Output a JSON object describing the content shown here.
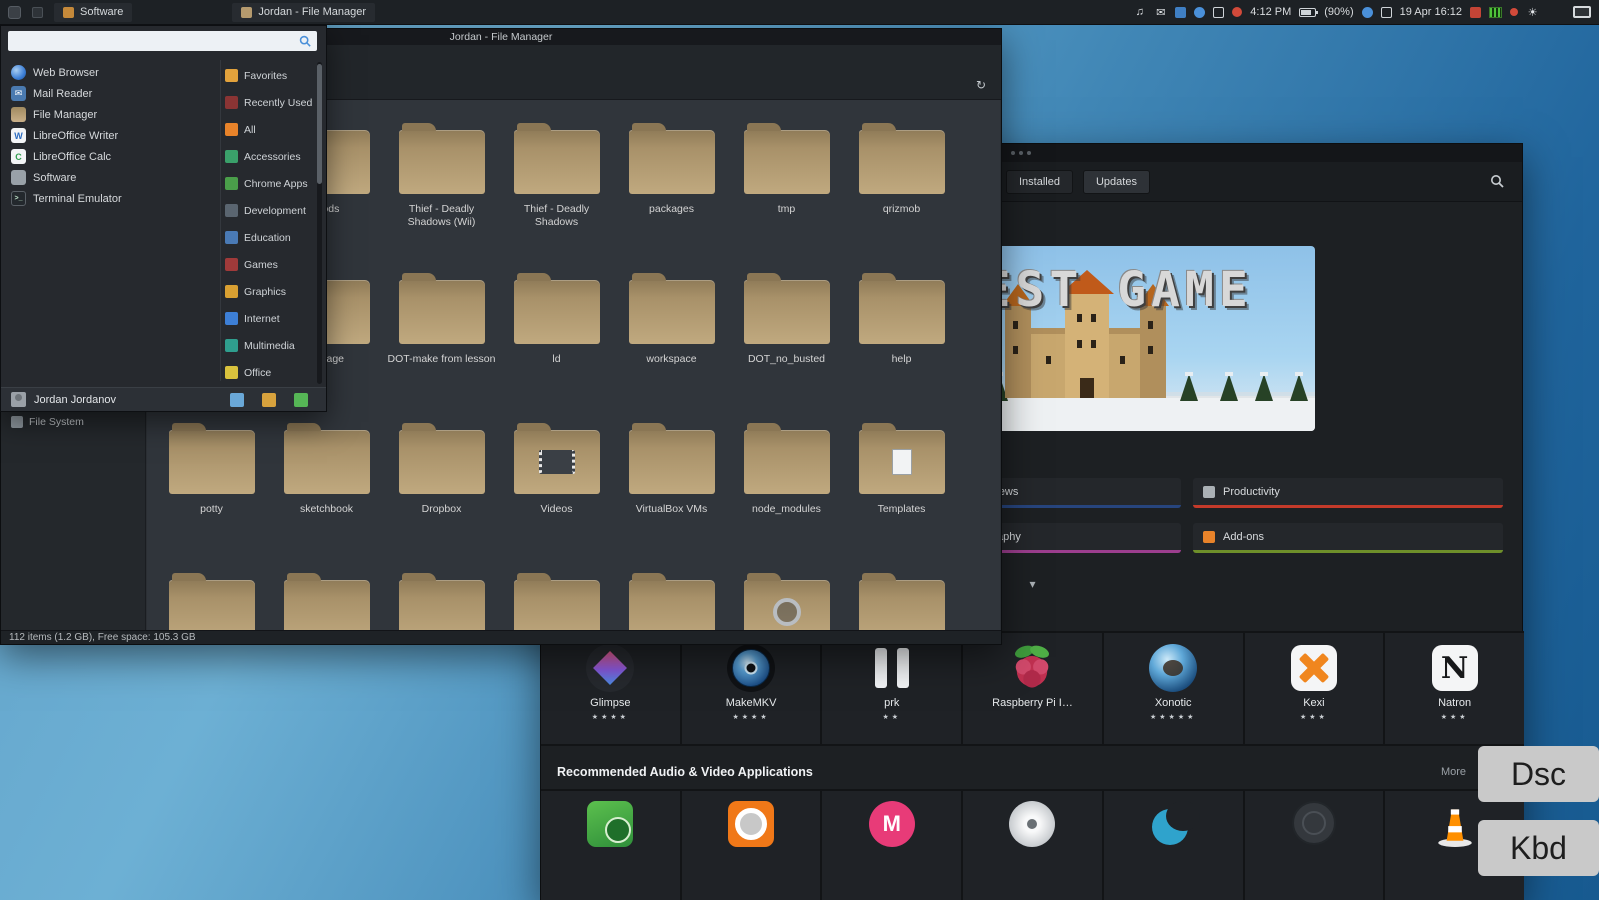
{
  "colors": {
    "desktop_top": "#6db0d4",
    "desktop_bottom": "#175a90",
    "panel_bg": "#1d2125",
    "window_dark": "#1d2023",
    "folder_tan": "#c0a97f",
    "accent_blue": "#4a90d9",
    "news_navy": "#27457e",
    "productivity_red": "#c43a2a",
    "photography_purple": "#9c3e8e",
    "addons_green": "#6e8f2a"
  },
  "icons": {
    "search": "magnifier",
    "volume": "note-glyph",
    "mail": "envelope-glyph",
    "brightness": "sun-glyph",
    "reload": "circular-arrow",
    "expander": "chevron-down"
  },
  "panel": {
    "tasks": [
      {
        "label": "Software"
      },
      {
        "label": "Jordan - File Manager"
      }
    ],
    "clock": "4:12 PM",
    "battery": "(90%)",
    "datetime": "19 Apr 16:12"
  },
  "menu": {
    "search_placeholder": "",
    "apps": [
      {
        "label": "Web Browser"
      },
      {
        "label": "Mail Reader"
      },
      {
        "label": "File Manager"
      },
      {
        "label": "LibreOffice Writer"
      },
      {
        "label": "LibreOffice Calc"
      },
      {
        "label": "Software"
      },
      {
        "label": "Terminal Emulator"
      }
    ],
    "categories": [
      {
        "label": "Favorites"
      },
      {
        "label": "Recently Used"
      },
      {
        "label": "All"
      },
      {
        "label": "Accessories"
      },
      {
        "label": "Chrome Apps"
      },
      {
        "label": "Development"
      },
      {
        "label": "Education"
      },
      {
        "label": "Games"
      },
      {
        "label": "Graphics"
      },
      {
        "label": "Internet"
      },
      {
        "label": "Multimedia"
      },
      {
        "label": "Office"
      }
    ],
    "user_name": "Jordan Jordanov"
  },
  "file_manager": {
    "title": "Jordan - File Manager",
    "sidebar_item": "File System",
    "folders": [
      {
        "label": ""
      },
      {
        "label": "mods"
      },
      {
        "label": "Thief - Deadly Shadows (Wii)"
      },
      {
        "label": "Thief - Deadly Shadows"
      },
      {
        "label": "packages"
      },
      {
        "label": "tmp"
      },
      {
        "label": "qrizmob"
      },
      {
        "label": ""
      },
      {
        "label": "storage"
      },
      {
        "label": "DOT-make from lesson"
      },
      {
        "label": "ld"
      },
      {
        "label": "workspace"
      },
      {
        "label": "DOT_no_busted"
      },
      {
        "label": "help"
      },
      {
        "label": "potty"
      },
      {
        "label": "sketchbook"
      },
      {
        "label": "Dropbox"
      },
      {
        "label": "Videos"
      },
      {
        "label": "VirtualBox VMs"
      },
      {
        "label": "node_modules"
      },
      {
        "label": "Templates"
      },
      {
        "label": ""
      },
      {
        "label": ""
      },
      {
        "label": ""
      },
      {
        "label": ""
      },
      {
        "label": ""
      },
      {
        "label": ""
      },
      {
        "label": ""
      }
    ],
    "status": "112 items (1.2 GB), Free space: 105.3 GB"
  },
  "software": {
    "tabs": [
      {
        "label": "Installed"
      },
      {
        "label": "Updates"
      }
    ],
    "banner_title": "MINETEST GAME",
    "category_tiles": [
      {
        "label": "Communication & News",
        "color": "#27457e"
      },
      {
        "label": "Productivity",
        "color": "#c43a2a"
      },
      {
        "label": "Graphics & Photography",
        "color": "#9c3e8e"
      },
      {
        "label": "Add-ons",
        "color": "#6e8f2a"
      }
    ],
    "featured_apps": [
      {
        "name": "Glimpse",
        "stars": "★★★★"
      },
      {
        "name": "MakeMKV",
        "stars": "★★★★"
      },
      {
        "name": "prk",
        "stars": "★★"
      },
      {
        "name": "Raspberry Pi I…",
        "stars": ""
      },
      {
        "name": "Xonotic",
        "stars": "★★★★★"
      },
      {
        "name": "Kexi",
        "stars": "★★★"
      },
      {
        "name": "Natron",
        "stars": "★★★"
      }
    ],
    "section_title": "Recommended Audio & Video Applications",
    "section_more": "More"
  },
  "overlays": {
    "dsc": "Dsc",
    "kbd": "Kbd"
  }
}
